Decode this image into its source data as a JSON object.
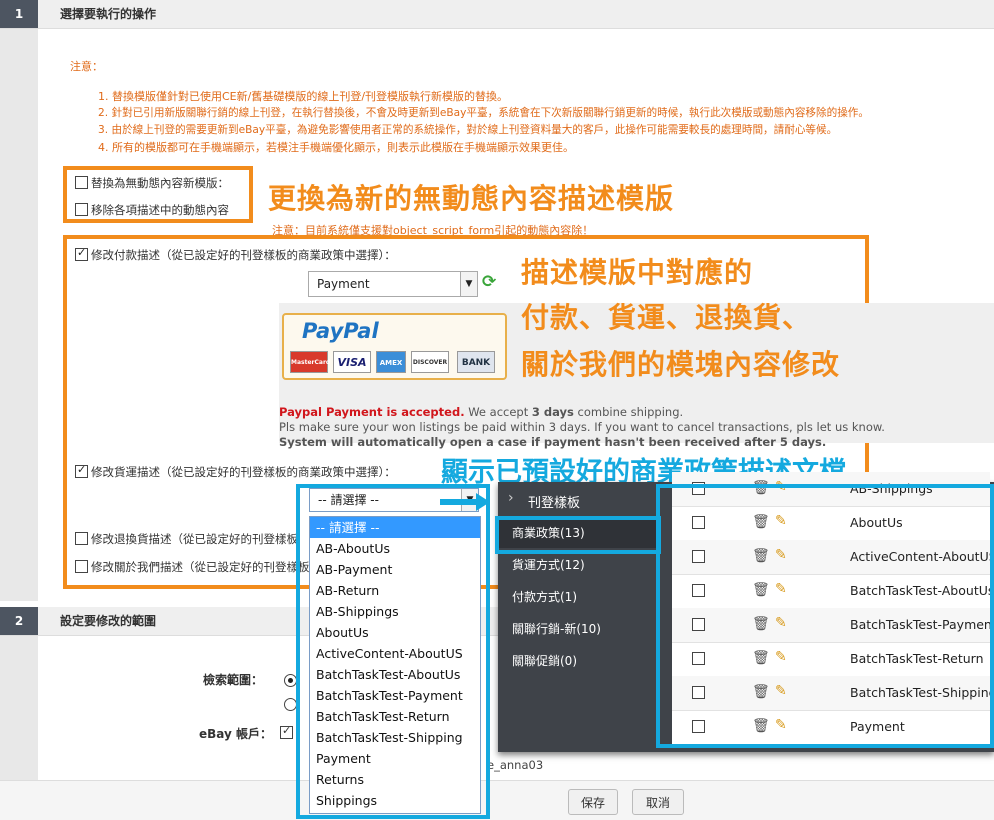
{
  "section1": {
    "num": "1",
    "title": "選擇要執行的操作"
  },
  "notes": {
    "label": "注意：",
    "n1": "1. 替換模版僅針對已使用CE新/舊基礎模版的線上刊登/刊登模版執行新模版的替換。",
    "n2": "2. 針對已引用新版關聯行銷的線上刊登，在執行替換後，不會及時更新到eBay平臺，系統會在下次新版關聯行銷更新的時候，執行此次模版或動態內容移除的操作。",
    "n3": "3. 由於線上刊登的需要更新到eBay平臺，為避免影響使用者正常的系統操作，對於線上刊登資料量大的客戶，此操作可能需要較長的處理時間，請耐心等候。",
    "n4": "4. 所有的模版都可在手機端顯示，若模注手機端優化顯示，則表示此模版在手機端顯示效果更佳。"
  },
  "options": {
    "replace_template": "替換為無動態內容新模版：",
    "remove_dynamic": "移除各項描述中的動態內容",
    "dynamic_note": "注意：目前系統僅支援對object_script_form引起的動態內容除！",
    "payment_desc": "修改付款描述（從已設定好的刊登樣板的商業政策中選擇）：",
    "shipping_desc": "修改貨運描述（從已設定好的刊登樣板的商業政策中選擇）：",
    "return_desc": "修改退換貨描述（從已設定好的刊登樣板",
    "about_desc": "修改關於我們描述（從已設定好的刊登樣板"
  },
  "payment_select": {
    "value": "Payment"
  },
  "paypal": {
    "logo": "PayPal",
    "cards": [
      "MasterCard",
      "VISA",
      "AMEX",
      "DISCOVER",
      "BANK"
    ],
    "accepted": "Paypal Payment is accepted.",
    "line1_rest": " We accept ",
    "line1_days": "3 days",
    "line1_end": " combine shipping.",
    "line2": "Pls make sure your won listings be paid within 3 days. If you want to cancel transactions, pls let us know.",
    "line3": "System  will automatically open a case if payment hasn't been received after 5 days."
  },
  "annotations": {
    "orange1": "更換為新的無動態內容描述模版",
    "orange2_l1": "描述模版中對應的",
    "orange2_l2": "付款、貨運、退換貨、",
    "orange2_l3": "關於我們的模塊內容修改",
    "blue1": "顯示已預設好的商業政策描述文檔"
  },
  "shipping_select": {
    "value": "-- 請選擇 --"
  },
  "dropdown_options": [
    "-- 請選擇 --",
    "AB-AboutUs",
    "AB-Payment",
    "AB-Return",
    "AB-Shippings",
    "AboutUs",
    "ActiveContent-AboutUS",
    "BatchTaskTest-AboutUs",
    "BatchTaskTest-Payment",
    "BatchTaskTest-Return",
    "BatchTaskTest-Shipping",
    "Payment",
    "Returns",
    "Shippings"
  ],
  "side_menu": {
    "header": "刊登樣板",
    "items": [
      "商業政策(13)",
      "貨運方式(12)",
      "付款方式(1)",
      "關聯行銷-新(10)",
      "關聯促銷(0)"
    ]
  },
  "policy_table": [
    "AB-Shippings",
    "AboutUs",
    "ActiveContent-AboutUS",
    "BatchTaskTest-AboutUs",
    "BatchTaskTest-Payment",
    "BatchTaskTest-Return",
    "BatchTaskTest-Shipping",
    "Payment"
  ],
  "section2": {
    "num": "2",
    "title": "設定要修改的範圍"
  },
  "scope": {
    "search_label": "檢索範圍：",
    "ebay_label": "eBay 帳戶：",
    "account_frag": "e_anna03"
  },
  "footer": {
    "save": "保存",
    "cancel": "取消"
  },
  "colors": {
    "orange": "#f28c1c",
    "blue": "#14a9df",
    "dark": "#3f4349"
  }
}
